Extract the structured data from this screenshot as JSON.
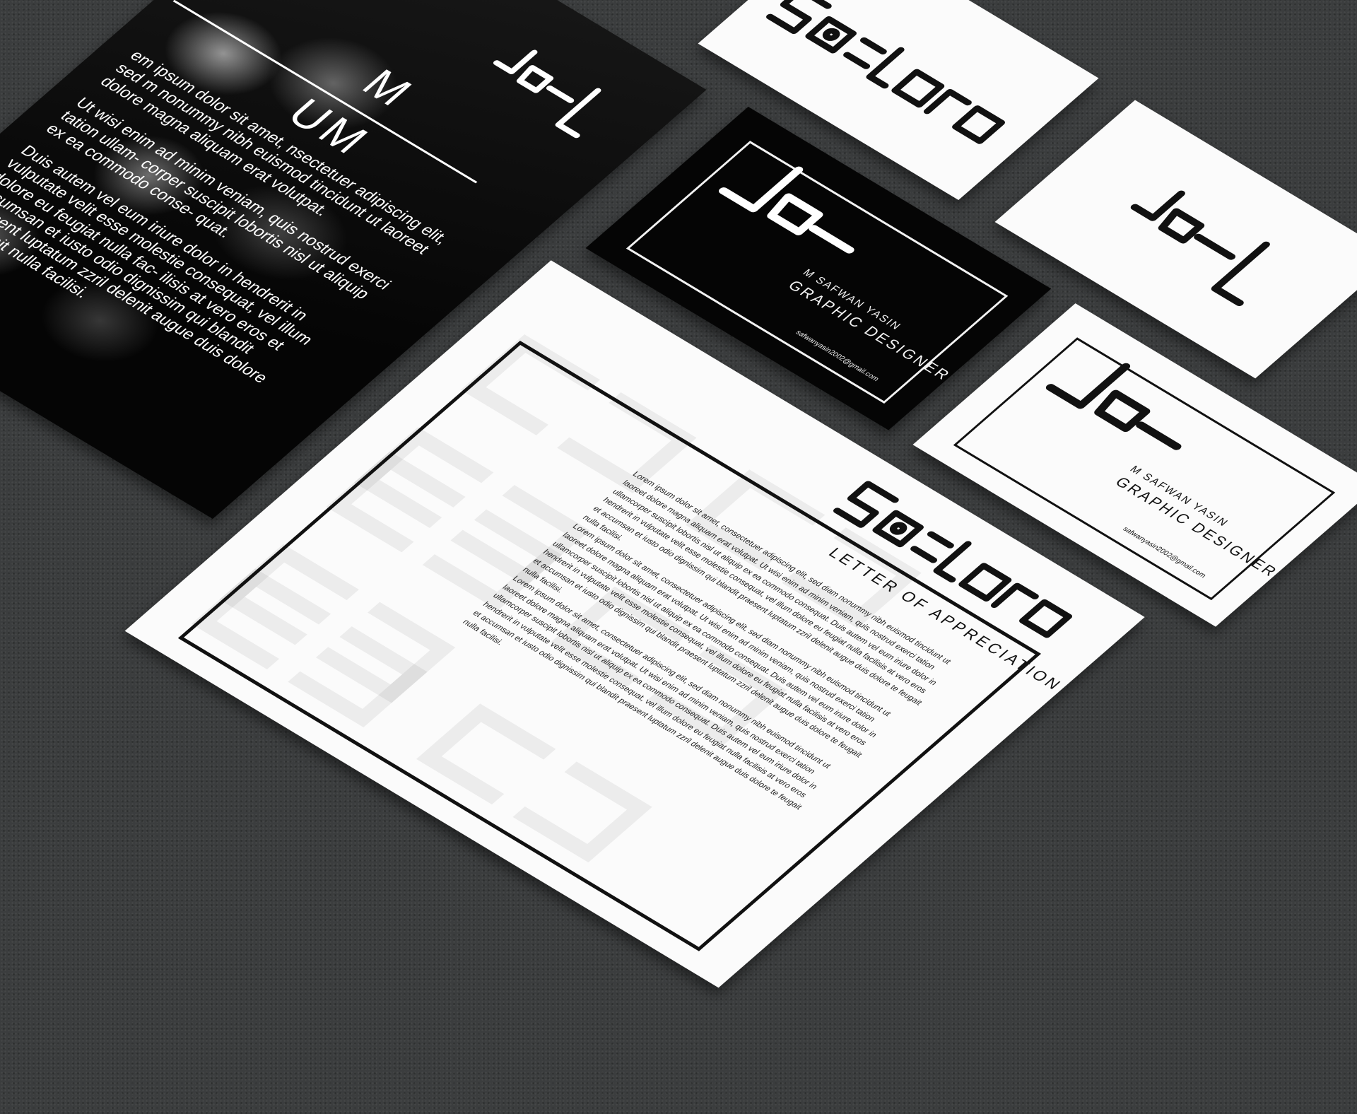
{
  "wordmark": {
    "alt": "safwan yasin wordmark"
  },
  "business_card": {
    "name": "M SAFWAN YASIN",
    "title": "GRAPHIC DESIGNER",
    "email": "safwanyasin2002@gmail.com"
  },
  "poster": {
    "heading_line1": "M",
    "heading_line2": "UM",
    "paragraph1": "em ipsum dolor sit amet, nsectetuer adipiscing elit, sed m nonummy nibh euismod tincidunt ut laoreet dolore magna aliquam erat volutpat.",
    "paragraph2": "Ut wisi enim ad minim veniam, quis nostrud exerci tation ullam- corper suscipit lobortis nisl ut aliquip ex ea commodo conse- quat.",
    "paragraph3": "Duis autem vel eum iriure dolor in hendrerit in vulputate velit esse molestie consequat, vel illum dolore eu feugiat nulla fac- ilisis at vero eros et accumsan et iusto odio dignissim qui blandit praesent luptatum zzril delenit augue duis dolore te feugait nulla facilisi."
  },
  "letter": {
    "title": "LETTER OF APPRECIATION",
    "paragraphs": [
      "Lorem ipsum dolor sit amet, consectetuer adipiscing elit, sed diam nonummy nibh euismod tincidunt ut laoreet dolore magna aliquam erat volutpat. Ut wisi enim ad minim veniam, quis nostrud exerci tation ullamcorper suscipit lobortis nisl ut aliquip ex ea commodo consequat. Duis autem vel eum iriure dolor in hendrerit in vulputate velit esse molestie consequat, vel illum dolore eu feugiat nulla facilisis at vero eros et accumsan et iusto odio dignissim qui blandit praesent luptatum zzril delenit augue duis dolore te feugait nulla facilisi.",
      "Lorem ipsum dolor sit amet, consectetuer adipiscing elit, sed diam nonummy nibh euismod tincidunt ut laoreet dolore magna aliquam erat volutpat. Ut wisi enim ad minim veniam, quis nostrud exerci tation ullamcorper suscipit lobortis nisl ut aliquip ex ea commodo consequat. Duis autem vel eum iriure dolor in hendrerit in vulputate velit esse molestie consequat, vel illum dolore eu feugiat nulla facilisis at vero eros et accumsan et iusto odio dignissim qui blandit praesent luptatum zzril delenit augue duis dolore te feugait nulla facilisi.",
      "Lorem ipsum dolor sit amet, consectetuer adipiscing elit, sed diam nonummy nibh euismod tincidunt ut laoreet dolore magna aliquam erat volutpat. Ut wisi enim ad minim veniam, quis nostrud exerci tation ullamcorper suscipit lobortis nisl ut aliquip ex ea commodo consequat. Duis autem vel eum iriure dolor in hendrerit in vulputate velit esse molestie consequat, vel illum dolore eu feugiat nulla facilisis at vero eros et accumsan et iusto odio dignissim qui blandit praesent luptatum zzril delenit augue duis dolore te feugait nulla facilisi."
    ]
  },
  "colors": {
    "background": "#3b3d3e",
    "paper": "#fbfbfb",
    "ink": "#050505"
  }
}
